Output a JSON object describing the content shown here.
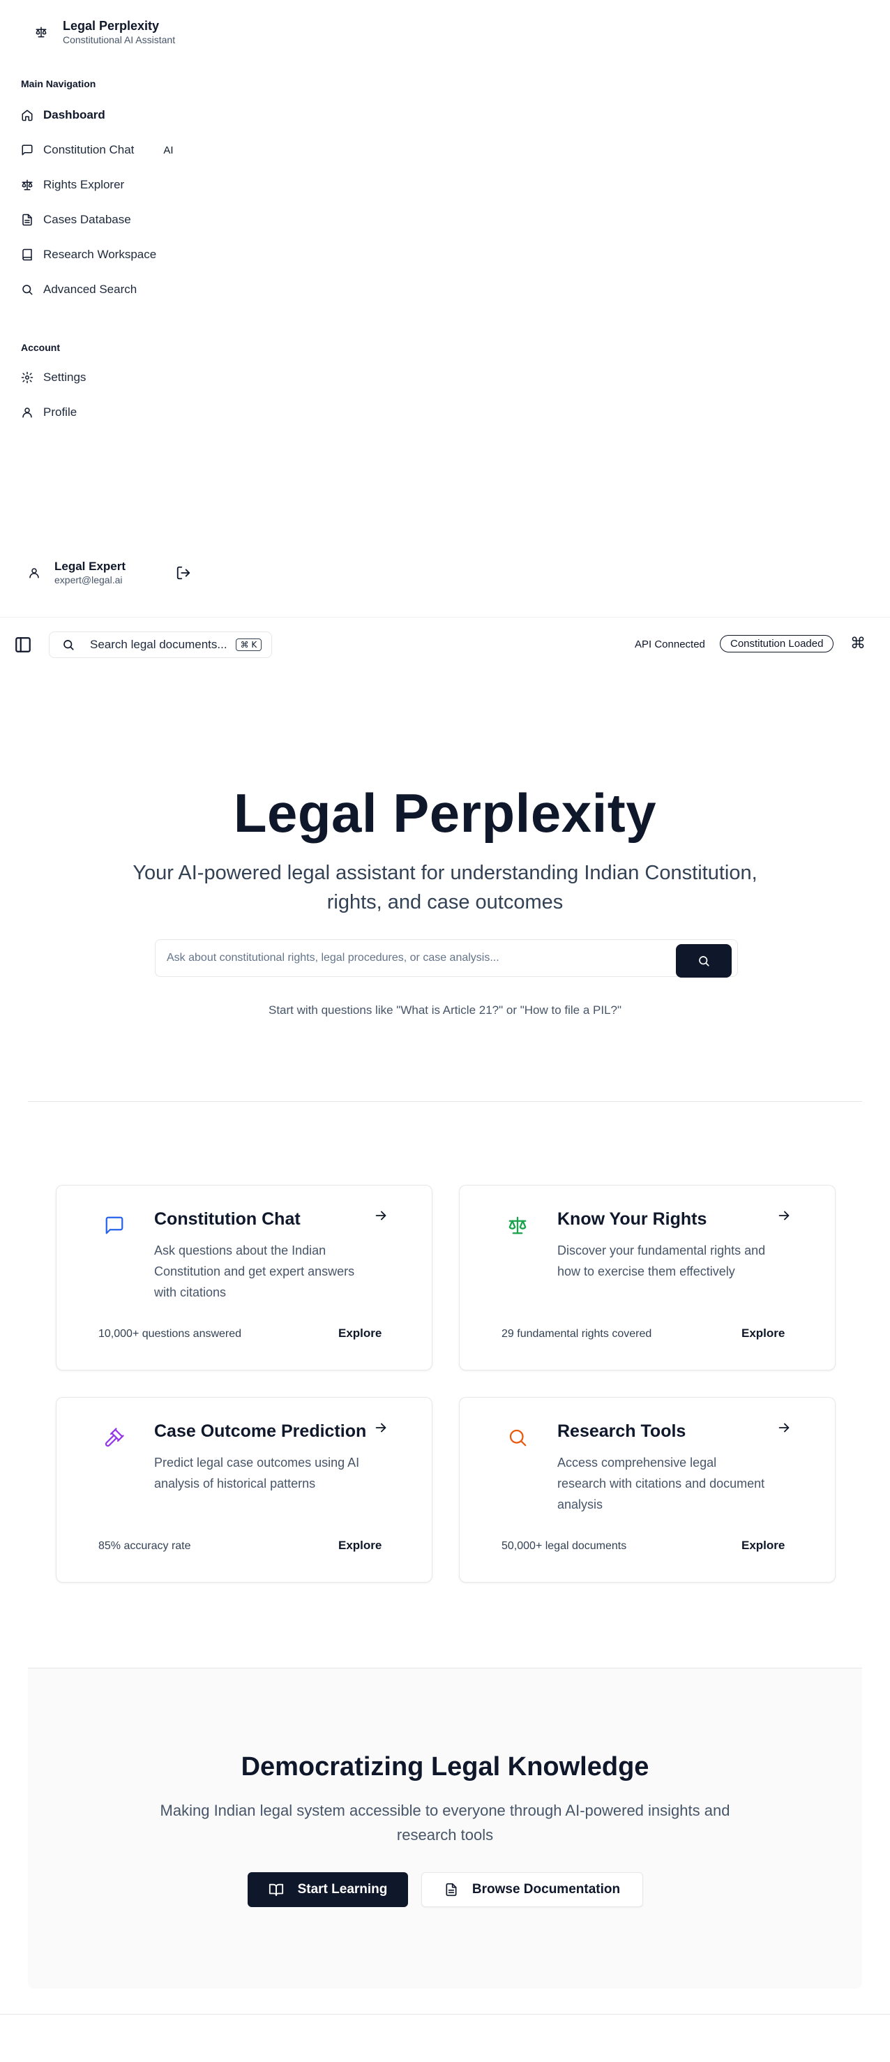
{
  "app": {
    "title": "Legal Perplexity",
    "subtitle": "Constitutional AI Assistant"
  },
  "sidebar": {
    "main_label": "Main Navigation",
    "items": [
      {
        "label": "Dashboard",
        "icon": "home-icon",
        "active": true
      },
      {
        "label": "Constitution Chat",
        "icon": "message-icon",
        "badge": "AI"
      },
      {
        "label": "Rights Explorer",
        "icon": "scale-icon"
      },
      {
        "label": "Cases Database",
        "icon": "file-text-icon"
      },
      {
        "label": "Research Workspace",
        "icon": "book-icon"
      },
      {
        "label": "Advanced Search",
        "icon": "search-icon"
      }
    ],
    "account_label": "Account",
    "account_items": [
      {
        "label": "Settings",
        "icon": "gear-icon"
      },
      {
        "label": "Profile",
        "icon": "user-icon"
      }
    ],
    "user": {
      "name": "Legal Expert",
      "email": "expert@legal.ai"
    }
  },
  "topbar": {
    "search_placeholder": "Search legal documents...",
    "shortcut": "⌘ K",
    "api_status": "API Connected",
    "constitution_status": "Constitution Loaded",
    "command_glyph": "⌘"
  },
  "hero": {
    "title": "Legal Perplexity",
    "subtitle": "Your AI-powered legal assistant for understanding Indian Constitution, rights, and case outcomes",
    "input_placeholder": "Ask about constitutional rights, legal procedures, or case analysis...",
    "hint": "Start with questions like \"What is Article 21?\" or \"How to file a PIL?\""
  },
  "cards": [
    {
      "title": "Constitution Chat",
      "description": "Ask questions about the Indian Constitution and get expert answers with citations",
      "stat": "10,000+ questions answered",
      "cta": "Explore",
      "icon": "message-icon",
      "color": "#2563eb"
    },
    {
      "title": "Know Your Rights",
      "description": "Discover your fundamental rights and how to exercise them effectively",
      "stat": "29 fundamental rights covered",
      "cta": "Explore",
      "icon": "scale-icon",
      "color": "#16a34a"
    },
    {
      "title": "Case Outcome Prediction",
      "description": "Predict legal case outcomes using AI analysis of historical patterns",
      "stat": "85% accuracy rate",
      "cta": "Explore",
      "icon": "gavel-icon",
      "color": "#9333ea"
    },
    {
      "title": "Research Tools",
      "description": "Access comprehensive legal research with citations and document analysis",
      "stat": "50,000+ legal documents",
      "cta": "Explore",
      "icon": "search-icon",
      "color": "#ea580c"
    }
  ],
  "cta": {
    "title": "Democratizing Legal Knowledge",
    "subtitle": "Making Indian legal system accessible to everyone through AI-powered insights and research tools",
    "primary_label": "Start Learning",
    "secondary_label": "Browse Documentation"
  }
}
